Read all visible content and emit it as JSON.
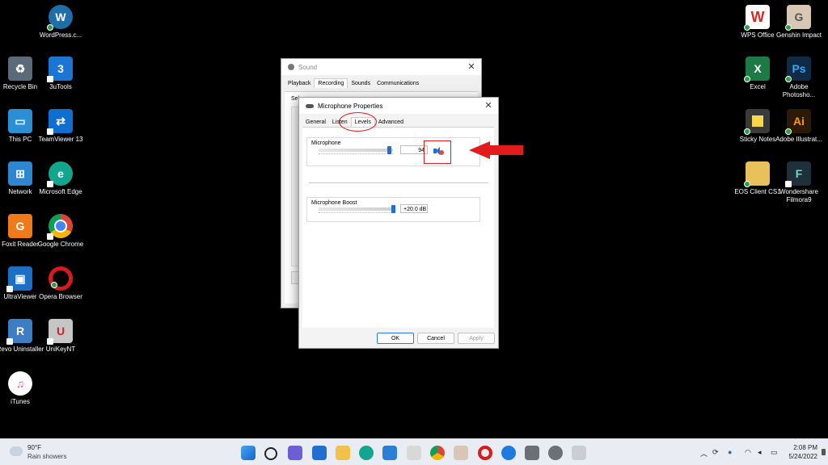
{
  "desktop": {
    "left_icons": [
      {
        "label": "WordPress.c...",
        "color": "#1e6ea7",
        "glyph": "W"
      },
      {
        "label": "Recycle Bin",
        "color": "#5a6a78",
        "glyph": "♻"
      },
      {
        "label": "3uTools",
        "color": "#1a76d2",
        "glyph": "3"
      },
      {
        "label": "This PC",
        "color": "#2b8fd6",
        "glyph": "▭"
      },
      {
        "label": "TeamViewer 13",
        "color": "#0e6fd1",
        "glyph": "⇄"
      },
      {
        "label": "Network",
        "color": "#2f86d0",
        "glyph": "⊞"
      },
      {
        "label": "Microsoft Edge",
        "color": "#14a58f",
        "glyph": "e"
      },
      {
        "label": "Foxit Reader",
        "color": "#f07a1a",
        "glyph": "G"
      },
      {
        "label": "Google Chrome",
        "color": "#e0a21b",
        "glyph": "●"
      },
      {
        "label": "UltraViewer",
        "color": "#1b6fc4",
        "glyph": "▣"
      },
      {
        "label": "Opera Browser",
        "color": "#d91a1a",
        "glyph": "O"
      },
      {
        "label": "Revo Uninstaller",
        "color": "#3c7dc4",
        "glyph": "R"
      },
      {
        "label": "UniKeyNT",
        "color": "#c6c6c6",
        "glyph": "U"
      },
      {
        "label": "iTunes",
        "color": "#e94fa8",
        "glyph": "♫"
      }
    ],
    "right_icons": [
      {
        "label": "WPS Office",
        "color": "#d32a2a",
        "glyph": "W"
      },
      {
        "label": "Genshin Impact",
        "color": "#d8c7b4",
        "glyph": "G"
      },
      {
        "label": "Excel",
        "color": "#1d7a45",
        "glyph": "X"
      },
      {
        "label": "Adobe Photosho...",
        "color": "#0f2a44",
        "glyph": "Ps"
      },
      {
        "label": "Sticky Notes",
        "color": "#f6d84a",
        "glyph": "▪"
      },
      {
        "label": "Adobe Illustrat...",
        "color": "#2d1a06",
        "glyph": "Ai"
      },
      {
        "label": "EOS Client CS1",
        "color": "#e8c15a",
        "glyph": "▬"
      },
      {
        "label": "Wondershare Filmora9",
        "color": "#20303a",
        "glyph": "F"
      }
    ]
  },
  "sound_window": {
    "title": "Sound",
    "tabs": [
      "Playback",
      "Recording",
      "Sounds",
      "Communications"
    ],
    "active_tab": "Recording",
    "partial_text": "Sel"
  },
  "mic_window": {
    "title": "Microphone Properties",
    "tabs": [
      "General",
      "Listen",
      "Levels",
      "Advanced"
    ],
    "active_tab": "Levels",
    "microphone": {
      "label": "Microphone",
      "value": "94"
    },
    "boost": {
      "label": "Microphone Boost",
      "value": "+20.0 dB"
    },
    "buttons": {
      "ok": "OK",
      "cancel": "Cancel",
      "apply": "Apply"
    }
  },
  "taskbar": {
    "weather_temp": "90°F",
    "weather_desc": "Rain showers",
    "time": "2:08 PM",
    "date": "5/24/2022"
  },
  "colors": {
    "annotation_red": "#e21b1b",
    "accent_blue": "#1f6fd1",
    "taskbar": "#e9edf3"
  }
}
